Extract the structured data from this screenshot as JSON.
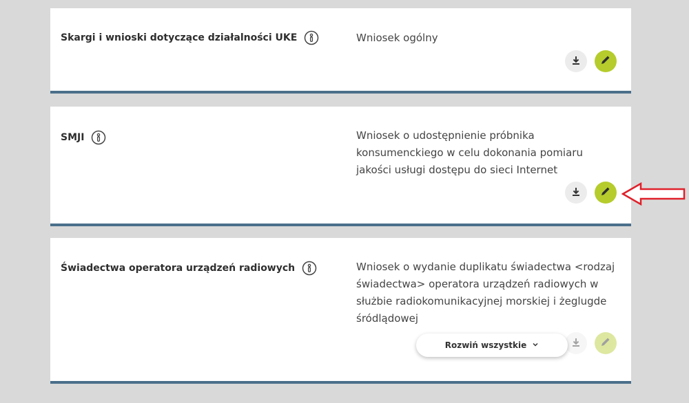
{
  "cards": [
    {
      "title": "Skargi i wnioski dotyczące działalności UKE",
      "description": "Wniosek ogólny"
    },
    {
      "title": "SMJI",
      "description": "Wniosek o udostępnienie próbnika konsumenckiego w celu dokonania pomiaru jakości usługi dostępu do sieci Internet"
    },
    {
      "title": "Świadectwa operatora urządzeń radiowych",
      "description": "Wniosek o wydanie duplikatu świadectwa <rodzaj świadectwa> operatora urządzeń radiowych w służbie radiokomunikacyjnej morskiej i żeglugde śródlądowej"
    }
  ],
  "expand_button": {
    "label": "Rozwiń wszystkie"
  },
  "icons": {
    "info": "info-icon",
    "download": "download-icon",
    "edit": "pencil-icon",
    "chevron": "chevron-down-icon",
    "annotation": "red-arrow-icon"
  },
  "colors": {
    "edit_button": "#b5cc2c",
    "card_border": "#4a6f8a",
    "annotation_arrow": "#e0202a"
  }
}
